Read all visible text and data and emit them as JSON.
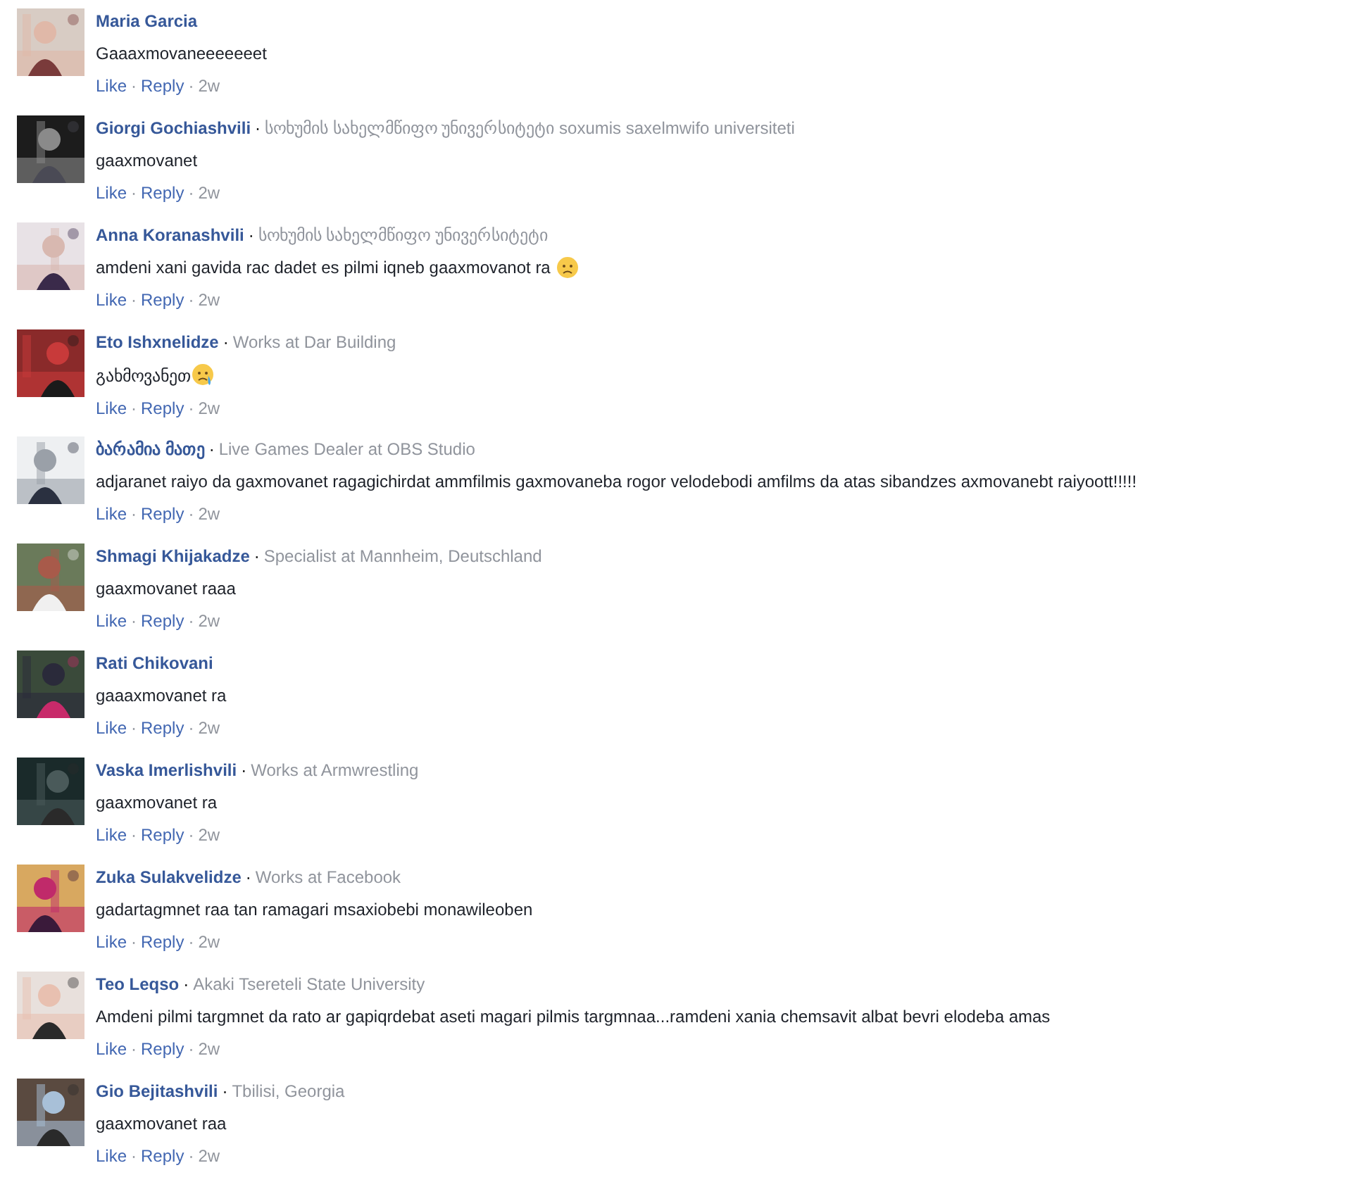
{
  "separator": "·",
  "comments": [
    {
      "name": "Maria Garcia",
      "text": "Gaaaxmovaneeeeeeet",
      "like": "Like",
      "reply": "Reply",
      "time": "2w"
    },
    {
      "name": "Giorgi Gochiashvili",
      "meta": "სოხუმის სახელმწიფო უნივერსიტეტი soxumis saxelmwifo universiteti",
      "text": "gaaxmovanet",
      "like": "Like",
      "reply": "Reply",
      "time": "2w"
    },
    {
      "name": "Anna Koranashvili",
      "meta": "სოხუმის სახელმწიფო უნივერსიტეტი",
      "text": "amdeni xani gavida rac dadet es pilmi iqneb gaaxmovanot ra",
      "emoji": {
        "kind": "worried"
      },
      "like": "Like",
      "reply": "Reply",
      "time": "2w"
    },
    {
      "name": "Eto Ishxnelidze",
      "meta": "Works at Dar Building",
      "text": "გახმოვანეთ",
      "emoji": {
        "kind": "crying"
      },
      "like": "Like",
      "reply": "Reply",
      "time": "2w"
    },
    {
      "name": "ბარამია მათე",
      "meta": "Live Games Dealer at OBS Studio",
      "text": "adjaranet raiyo da gaxmovanet ragagichirdat ammfilmis gaxmovaneba rogor velodebodi amfilms da atas sibandzes axmovanebt raiyoott!!!!!",
      "like": "Like",
      "reply": "Reply",
      "time": "2w"
    },
    {
      "name": "Shmagi Khijakadze",
      "meta": "Specialist at Mannheim, Deutschland",
      "text": "gaaxmovanet raaa",
      "like": "Like",
      "reply": "Reply",
      "time": "2w"
    },
    {
      "name": "Rati Chikovani",
      "text": "gaaaxmovanet ra",
      "like": "Like",
      "reply": "Reply",
      "time": "2w"
    },
    {
      "name": "Vaska Imerlishvili",
      "meta": "Works at Armwrestling",
      "text": "gaaxmovanet ra",
      "like": "Like",
      "reply": "Reply",
      "time": "2w"
    },
    {
      "name": "Zuka Sulakvelidze",
      "meta": "Works at Facebook",
      "text": "gadartagmnet raa tan ramagari msaxiobebi monawileoben",
      "like": "Like",
      "reply": "Reply",
      "time": "2w"
    },
    {
      "name": "Teo Leqso",
      "meta": "Akaki Tsereteli State University",
      "text": "Amdeni pilmi targmnet da rato ar gapiqrdebat aseti magari pilmis targmnaa...ramdeni xania chemsavit albat bevri elodeba amas",
      "like": "Like",
      "reply": "Reply",
      "time": "2w"
    },
    {
      "name": "Gio Bejitashvili",
      "meta": "Tbilisi, Georgia",
      "text": "gaaxmovanet raa",
      "like": "Like",
      "reply": "Reply",
      "time": "2w"
    }
  ]
}
